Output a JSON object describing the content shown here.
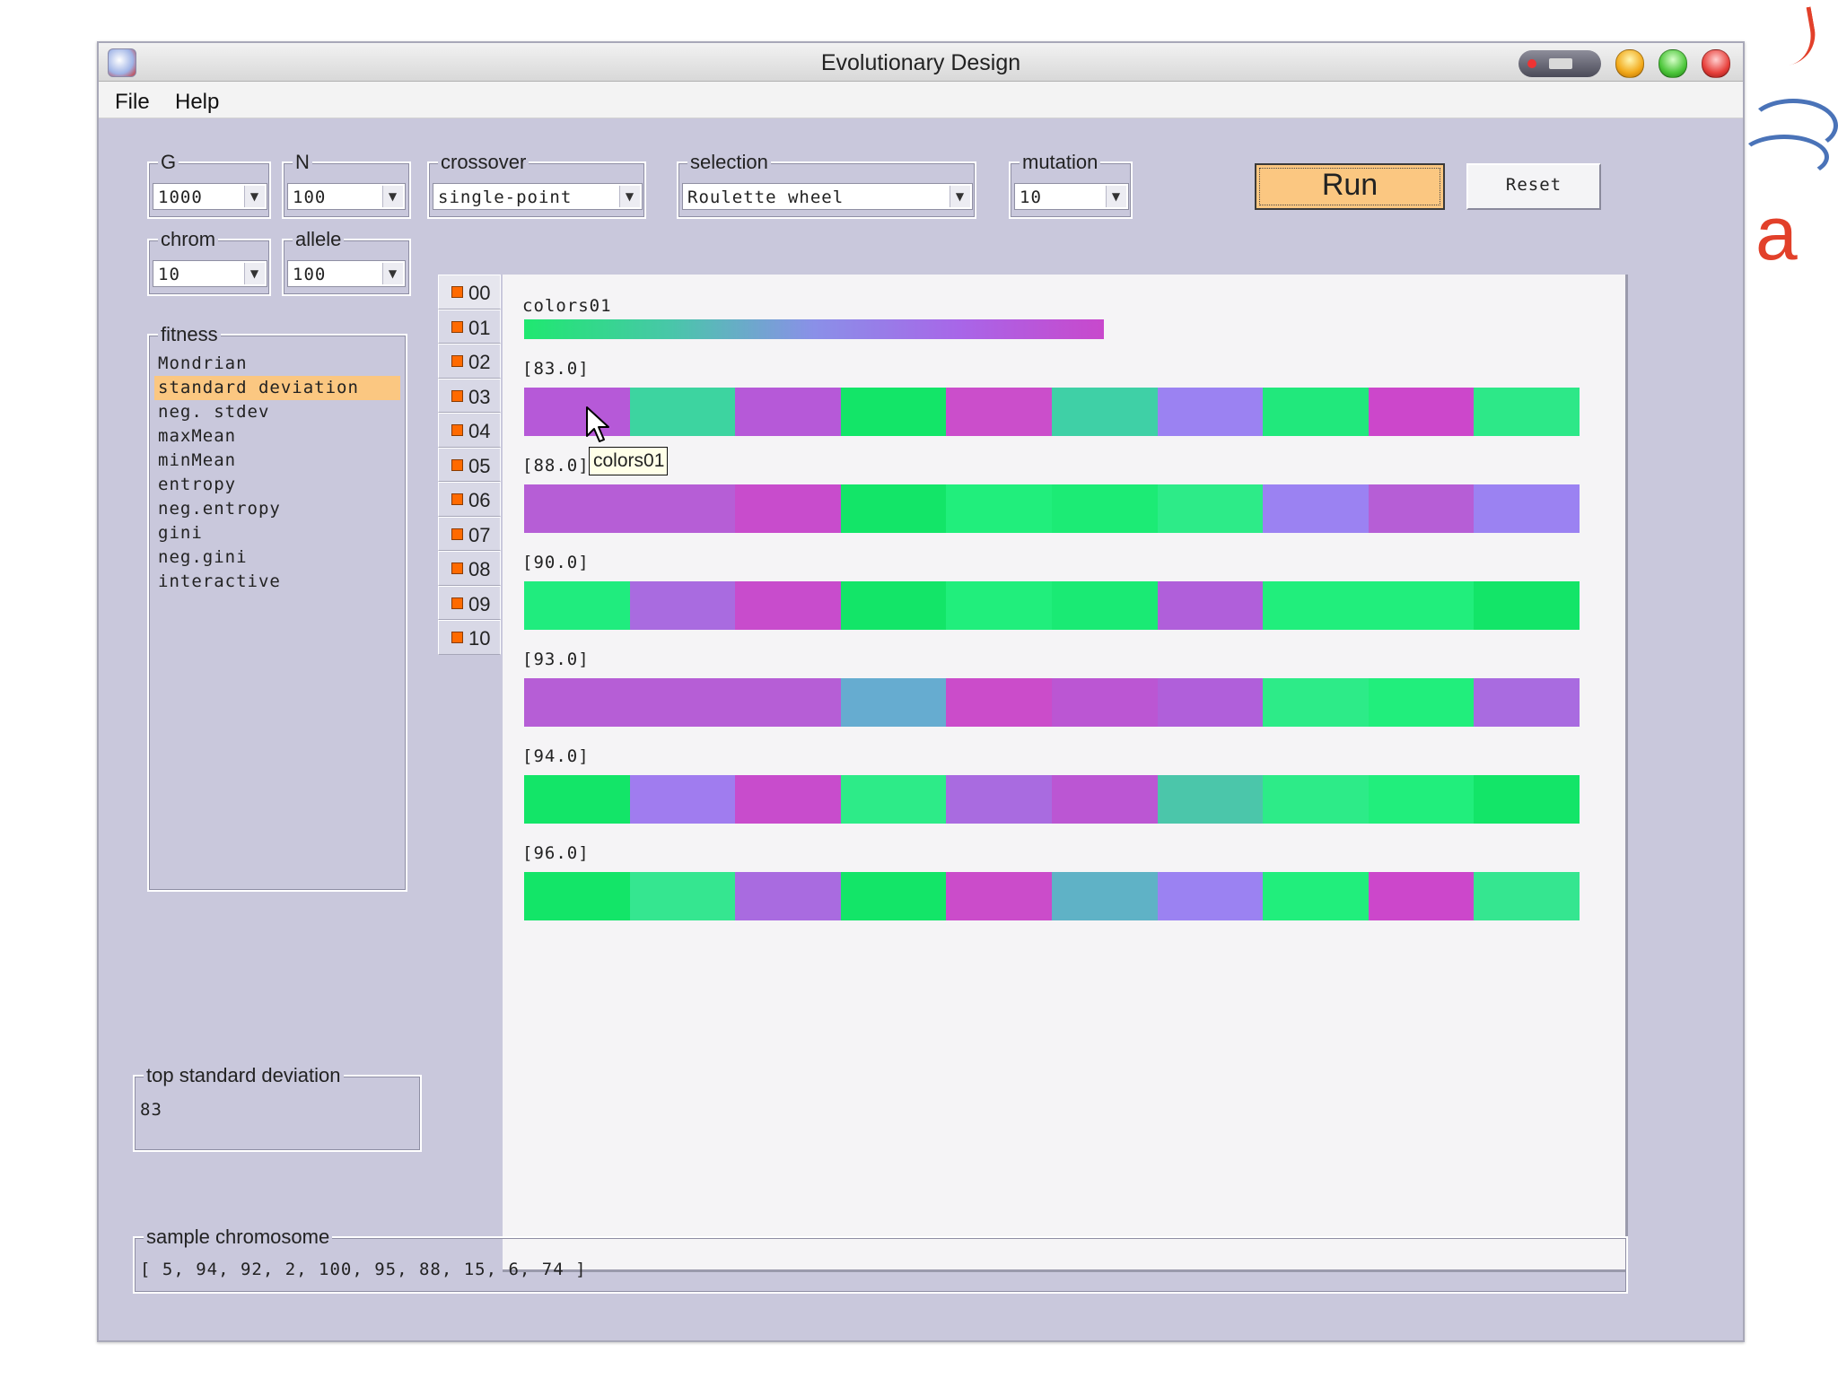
{
  "window": {
    "title": "Evolutionary Design"
  },
  "menu": {
    "file": "File",
    "help": "Help"
  },
  "params": {
    "g": {
      "label": "G",
      "value": "1000"
    },
    "n": {
      "label": "N",
      "value": "100"
    },
    "crossover": {
      "label": "crossover",
      "value": "single-point"
    },
    "selection": {
      "label": "selection",
      "value": "Roulette wheel"
    },
    "mutation": {
      "label": "mutation",
      "value": "10"
    },
    "chrom": {
      "label": "chrom",
      "value": "10"
    },
    "allele": {
      "label": "allele",
      "value": "100"
    }
  },
  "buttons": {
    "run": "Run",
    "reset": "Reset"
  },
  "fitness": {
    "label": "fitness",
    "selected": "standard deviation",
    "options": [
      "Mondrian",
      "standard deviation",
      "neg. stdev",
      "maxMean",
      "minMean",
      "entropy",
      "neg.entropy",
      "gini",
      "neg.gini",
      "interactive"
    ]
  },
  "tabs": [
    "00",
    "01",
    "02",
    "03",
    "04",
    "05",
    "06",
    "07",
    "08",
    "09",
    "10"
  ],
  "active_tab": "00",
  "tooltip": "colors01",
  "canvas": {
    "header": "colors01",
    "gradient": [
      "#1fe870",
      "#48c7a8",
      "#8a90e8",
      "#a866e8",
      "#c848cc"
    ],
    "strips": [
      {
        "label": "[83.0]",
        "colors": [
          "#b659d8",
          "#3dd4a0",
          "#b659d8",
          "#13e568",
          "#cb4ecb",
          "#3fd0a6",
          "#9b82f2",
          "#21e87c",
          "#cc47cb",
          "#2de888"
        ]
      },
      {
        "label": "[88.0]",
        "colors": [
          "#b65ed6",
          "#b65ed6",
          "#c84ccc",
          "#13e568",
          "#21ee7c",
          "#1ceb75",
          "#2deb88",
          "#9b82f2",
          "#b65ed6",
          "#9b82f2"
        ]
      },
      {
        "label": "[90.0]",
        "colors": [
          "#20ec7e",
          "#a96be0",
          "#c84ccc",
          "#13e568",
          "#21ee7c",
          "#1aea74",
          "#b05fda",
          "#21ee7c",
          "#21ee7c",
          "#13e568"
        ]
      },
      {
        "label": "[93.0]",
        "colors": [
          "#b65ed6",
          "#b65ed6",
          "#b65ed6",
          "#66acd0",
          "#cb4cca",
          "#bb56d3",
          "#b05fda",
          "#2deb88",
          "#21ee7c",
          "#a96be0"
        ]
      },
      {
        "label": "[94.0]",
        "colors": [
          "#13e568",
          "#a07cef",
          "#c84ccc",
          "#2deb88",
          "#a96be0",
          "#bb56d3",
          "#4bc6aa",
          "#2deb88",
          "#21ee7c",
          "#13e568"
        ]
      },
      {
        "label": "[96.0]",
        "colors": [
          "#13e568",
          "#35e690",
          "#a96be0",
          "#13e568",
          "#cb4cca",
          "#5fb2c6",
          "#9b82f2",
          "#21ee7c",
          "#cc47cb",
          "#35e690"
        ]
      }
    ]
  },
  "top_stat": {
    "label": "top standard deviation",
    "value": "83"
  },
  "sample": {
    "label": "sample chromosome",
    "value": "[ 5, 94, 92, 2, 100, 95, 88, 15, 6, 74 ]"
  },
  "colors": {
    "panel_bg": "#c9c8dc",
    "highlight": "#fbc781",
    "tab_marker": "#ff6a00"
  }
}
